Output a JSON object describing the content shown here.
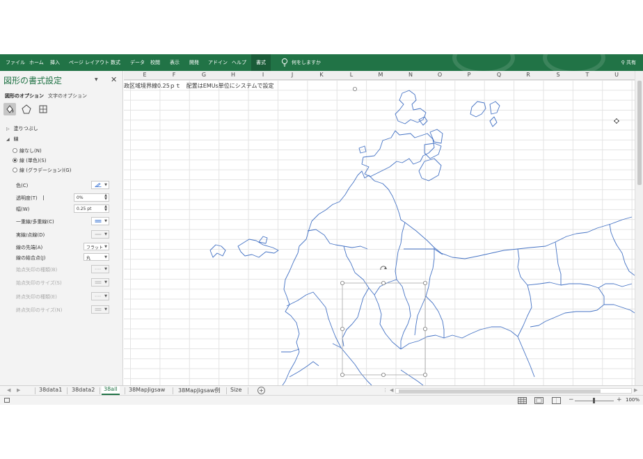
{
  "ribbon": {
    "tabs": [
      "ファイル",
      "ホーム",
      "挿入",
      "ページ レイアウト",
      "数式",
      "データ",
      "校閲",
      "表示",
      "開発",
      "アドイン",
      "ヘルプ"
    ],
    "active_tab": "書式",
    "tell_me": "何をしますか",
    "share": "共有",
    "accent_color": "#217346"
  },
  "pane": {
    "title": "図形の書式設定",
    "tab_shape": "図形のオプション",
    "tab_text": "文字のオプション",
    "icons": [
      "fill-line-icon",
      "effects-icon",
      "size-properties-icon"
    ],
    "fill_section": "塗りつぶし",
    "line_section": "線",
    "radios": [
      {
        "label": "線なし(N)",
        "checked": false
      },
      {
        "label": "線 (単色)(S)",
        "checked": true
      },
      {
        "label": "線 (グラデーション)(G)",
        "checked": false
      }
    ],
    "props": {
      "color": "色(C)",
      "transparency": "透明度(T)",
      "transparency_value": "0%",
      "width": "幅(W)",
      "width_value": "0.25 pt",
      "compound": "一重線/多重線(C)",
      "dash": "実線/点線(D)",
      "cap": "線の先端(A)",
      "cap_value": "フラット",
      "join": "線の結合点(J)",
      "join_value": "丸",
      "begin_arrow_type": "始点矢印の種類(B)",
      "begin_arrow_size": "始点矢印のサイズ(S)",
      "end_arrow_type": "終点矢印の種類(E)",
      "end_arrow_size": "終点矢印のサイズ(N)"
    }
  },
  "grid": {
    "columns": [
      "E",
      "F",
      "G",
      "H",
      "I",
      "J",
      "K",
      "L",
      "M",
      "N",
      "O",
      "P",
      "Q",
      "R",
      "S",
      "T",
      "U"
    ],
    "cell_text": "政区域境界線0.25ｐｔ　配置はEMUs単位にシステムで設定",
    "map_line_color": "#4472c4"
  },
  "sheets": {
    "tabs": [
      "38data1",
      "38data2",
      "38all",
      "38MapJigsaw",
      "38MapJigsaw例",
      "Size"
    ],
    "active": "38all",
    "add_label": "+"
  },
  "status": {
    "zoom": "100%"
  }
}
